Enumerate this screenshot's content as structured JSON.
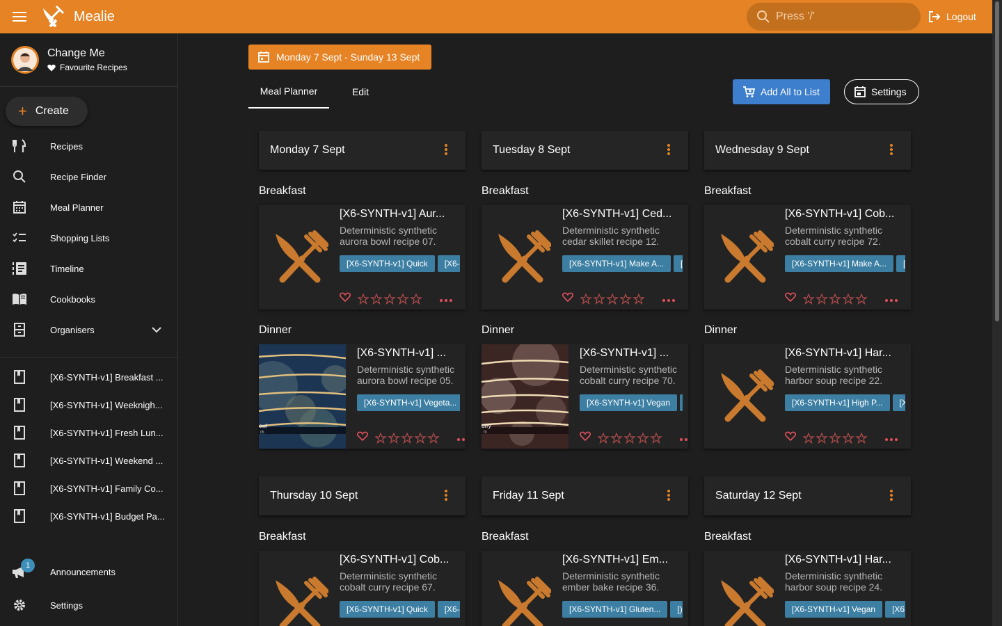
{
  "app": {
    "title": "Mealie",
    "search_placeholder": "Press '/'",
    "logout": "Logout"
  },
  "user": {
    "name": "Change Me",
    "favourites": "Favourite Recipes"
  },
  "sidebar": {
    "create": "Create",
    "items": [
      {
        "label": "Recipes",
        "icon": "fork-knife-icon"
      },
      {
        "label": "Recipe Finder",
        "icon": "search-icon"
      },
      {
        "label": "Meal Planner",
        "icon": "calendar-icon"
      },
      {
        "label": "Shopping Lists",
        "icon": "checklist-icon"
      },
      {
        "label": "Timeline",
        "icon": "timeline-icon"
      },
      {
        "label": "Cookbooks",
        "icon": "book-open-icon"
      },
      {
        "label": "Organisers",
        "icon": "organiser-icon"
      }
    ],
    "cookbooks": [
      "[X6-SYNTH-v1] Breakfast ...",
      "[X6-SYNTH-v1] Weeknigh...",
      "[X6-SYNTH-v1] Fresh Lun...",
      "[X6-SYNTH-v1] Weekend ...",
      "[X6-SYNTH-v1] Family Co...",
      "[X6-SYNTH-v1] Budget Pa..."
    ],
    "announcements": "Announcements",
    "announcements_count": "1",
    "settings": "Settings"
  },
  "planner": {
    "date_range": "Monday 7 Sept - Sunday 13 Sept",
    "tabs": [
      "Meal Planner",
      "Edit"
    ],
    "add_all": "Add All to List",
    "settings": "Settings",
    "days": [
      {
        "title": "Monday 7 Sept",
        "meals": [
          {
            "slot": "Breakfast",
            "title": "[X6-SYNTH-v1] Aur...",
            "desc": [
              "Deterministic synthetic",
              "aurora bowl recipe 07."
            ],
            "tags": [
              "[X6-SYNTH-v1] Quick",
              "[X6-"
            ],
            "image": "placeholder"
          },
          {
            "slot": "Dinner",
            "title": "[X6-SYNTH-v1] ...",
            "desc": [
              "Deterministic synthetic",
              "aurora bowl recipe 05."
            ],
            "tags": [
              "[X6-SYNTH-v1] Vegeta..."
            ],
            "image": "blue",
            "img_text": [
              "owl",
              "05"
            ]
          }
        ]
      },
      {
        "title": "Tuesday 8 Sept",
        "meals": [
          {
            "slot": "Breakfast",
            "title": "[X6-SYNTH-v1] Ced...",
            "desc": [
              "Deterministic synthetic",
              "cedar skillet recipe 12."
            ],
            "tags": [
              "[X6-SYNTH-v1] Make A...",
              "["
            ],
            "image": "placeholder"
          },
          {
            "slot": "Dinner",
            "title": "[X6-SYNTH-v1] ...",
            "desc": [
              "Deterministic synthetic",
              "cobalt curry recipe 70."
            ],
            "tags": [
              "[X6-SYNTH-v1] Vegan",
              "["
            ],
            "image": "brown",
            "img_text": [
              "urry",
              "70"
            ]
          }
        ]
      },
      {
        "title": "Wednesday 9 Sept",
        "meals": [
          {
            "slot": "Breakfast",
            "title": "[X6-SYNTH-v1] Cob...",
            "desc": [
              "Deterministic synthetic",
              "cobalt curry recipe 72."
            ],
            "tags": [
              "[X6-SYNTH-v1] Make A...",
              "["
            ],
            "image": "placeholder"
          },
          {
            "slot": "Dinner",
            "title": "[X6-SYNTH-v1] Har...",
            "desc": [
              "Deterministic synthetic",
              "harbor soup recipe 22."
            ],
            "tags": [
              "[X6-SYNTH-v1] High P...",
              "[X"
            ],
            "image": "placeholder"
          }
        ]
      },
      {
        "title": "Thursday 10 Sept",
        "meals": [
          {
            "slot": "Breakfast",
            "title": "[X6-SYNTH-v1] Cob...",
            "desc": [
              "Deterministic synthetic",
              "cobalt curry recipe 67."
            ],
            "tags": [
              "[X6-SYNTH-v1] Quick",
              "[X6-"
            ],
            "image": "placeholder"
          }
        ]
      },
      {
        "title": "Friday 11 Sept",
        "meals": [
          {
            "slot": "Breakfast",
            "title": "[X6-SYNTH-v1] Em...",
            "desc": [
              "Deterministic synthetic",
              "ember bake recipe 36."
            ],
            "tags": [
              "[X6-SYNTH-v1] Gluten...",
              "[)"
            ],
            "image": "placeholder"
          }
        ]
      },
      {
        "title": "Saturday 12 Sept",
        "meals": [
          {
            "slot": "Breakfast",
            "title": "[X6-SYNTH-v1] Har...",
            "desc": [
              "Deterministic synthetic",
              "harbor soup recipe 24."
            ],
            "tags": [
              "[X6-SYNTH-v1] Vegan",
              "[X6"
            ],
            "image": "placeholder"
          }
        ]
      }
    ]
  },
  "colors": {
    "primary": "#e58325",
    "accent": "#3d7fcc",
    "chip": "#3d7fa3",
    "heart": "#e0505a",
    "background": "#1e1e1e",
    "card": "#232323"
  }
}
